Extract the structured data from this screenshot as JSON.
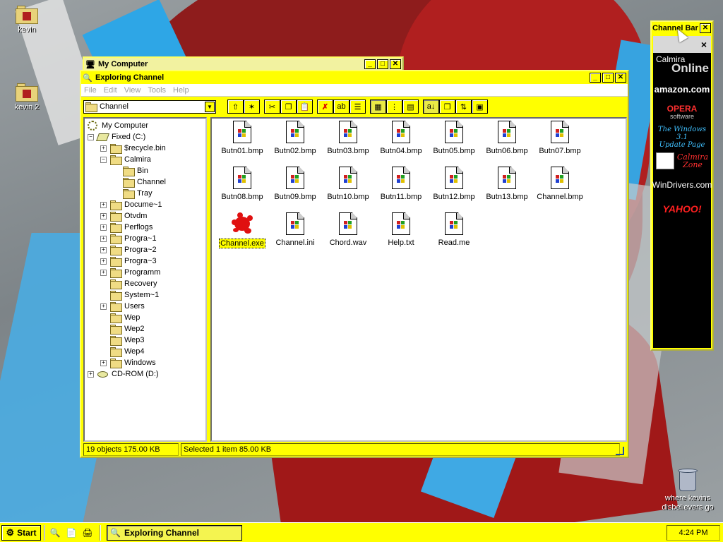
{
  "desktop": {
    "icons": [
      {
        "label": "kevin"
      },
      {
        "label": "kevin 2"
      }
    ],
    "recycle": {
      "label_line1": "where kevins",
      "label_line2": "disbelievers go"
    }
  },
  "my_computer_window": {
    "title": "My Computer"
  },
  "explorer": {
    "title": "Exploring Channel",
    "menu": [
      "File",
      "Edit",
      "View",
      "Tools",
      "Help"
    ],
    "combo_value": "Channel",
    "tree": [
      {
        "label": "My Computer",
        "level": 0,
        "icon": "computer",
        "pm": ""
      },
      {
        "label": "Fixed (C:)",
        "level": 0,
        "icon": "drive",
        "pm": "-"
      },
      {
        "label": "$recycle.bin",
        "level": 1,
        "icon": "folder",
        "pm": "+"
      },
      {
        "label": "Calmira",
        "level": 1,
        "icon": "folder",
        "pm": "-"
      },
      {
        "label": "Bin",
        "level": 2,
        "icon": "folder",
        "pm": ""
      },
      {
        "label": "Channel",
        "level": 2,
        "icon": "folder-open",
        "pm": ""
      },
      {
        "label": "Tray",
        "level": 2,
        "icon": "folder",
        "pm": ""
      },
      {
        "label": "Docume~1",
        "level": 1,
        "icon": "folder",
        "pm": "+"
      },
      {
        "label": "Otvdm",
        "level": 1,
        "icon": "folder",
        "pm": "+"
      },
      {
        "label": "Perflogs",
        "level": 1,
        "icon": "folder",
        "pm": "+"
      },
      {
        "label": "Progra~1",
        "level": 1,
        "icon": "folder",
        "pm": "+"
      },
      {
        "label": "Progra~2",
        "level": 1,
        "icon": "folder",
        "pm": "+"
      },
      {
        "label": "Progra~3",
        "level": 1,
        "icon": "folder",
        "pm": "+"
      },
      {
        "label": "Programm",
        "level": 1,
        "icon": "folder",
        "pm": "+"
      },
      {
        "label": "Recovery",
        "level": 1,
        "icon": "folder",
        "pm": ""
      },
      {
        "label": "System~1",
        "level": 1,
        "icon": "folder",
        "pm": ""
      },
      {
        "label": "Users",
        "level": 1,
        "icon": "folder",
        "pm": "+"
      },
      {
        "label": "Wep",
        "level": 1,
        "icon": "folder",
        "pm": ""
      },
      {
        "label": "Wep2",
        "level": 1,
        "icon": "folder",
        "pm": ""
      },
      {
        "label": "Wep3",
        "level": 1,
        "icon": "folder",
        "pm": ""
      },
      {
        "label": "Wep4",
        "level": 1,
        "icon": "folder",
        "pm": ""
      },
      {
        "label": "Windows",
        "level": 1,
        "icon": "folder",
        "pm": "+"
      },
      {
        "label": "CD-ROM (D:)",
        "level": 0,
        "icon": "cdrom",
        "pm": "+"
      }
    ],
    "files": [
      {
        "name": "Butn01.bmp",
        "icon": "doc"
      },
      {
        "name": "Butn02.bmp",
        "icon": "doc"
      },
      {
        "name": "Butn03.bmp",
        "icon": "doc"
      },
      {
        "name": "Butn04.bmp",
        "icon": "doc"
      },
      {
        "name": "Butn05.bmp",
        "icon": "doc"
      },
      {
        "name": "Butn06.bmp",
        "icon": "doc"
      },
      {
        "name": "Butn07.bmp",
        "icon": "doc"
      },
      {
        "name": "Butn08.bmp",
        "icon": "doc"
      },
      {
        "name": "Butn09.bmp",
        "icon": "doc"
      },
      {
        "name": "Butn10.bmp",
        "icon": "doc"
      },
      {
        "name": "Butn11.bmp",
        "icon": "doc"
      },
      {
        "name": "Butn12.bmp",
        "icon": "doc"
      },
      {
        "name": "Butn13.bmp",
        "icon": "doc"
      },
      {
        "name": "Channel.bmp",
        "icon": "doc"
      },
      {
        "name": "Channel.exe",
        "icon": "splat",
        "selected": true
      },
      {
        "name": "Channel.ini",
        "icon": "doc"
      },
      {
        "name": "Chord.wav",
        "icon": "doc"
      },
      {
        "name": "Help.txt",
        "icon": "doc"
      },
      {
        "name": "Read.me",
        "icon": "doc"
      }
    ],
    "status_objects": "19 objects  175.00 KB",
    "status_selected": "Selected 1 item  85.00 KB"
  },
  "channel_bar": {
    "title": "Channel Bar",
    "close_glyph": "×",
    "channels": {
      "calmira_small": "Calmira",
      "calmira_big": "Online",
      "amazon": "amazon.com",
      "opera_1": "OPERA",
      "opera_2": "software",
      "win31_1": "The Windows 3.1",
      "win31_2": "Update Page",
      "zone_1": "Calmira",
      "zone_2": "Zone",
      "windrivers": "WinDrivers.com",
      "yahoo": "YAHOO!"
    }
  },
  "taskbar": {
    "start_label": "Start",
    "task_label": "Exploring Channel",
    "clock": "4:24 PM"
  },
  "colors": {
    "theme": "#ffff00",
    "channel_bar_background": "#000000",
    "selected_file_icon": "#e01010"
  }
}
